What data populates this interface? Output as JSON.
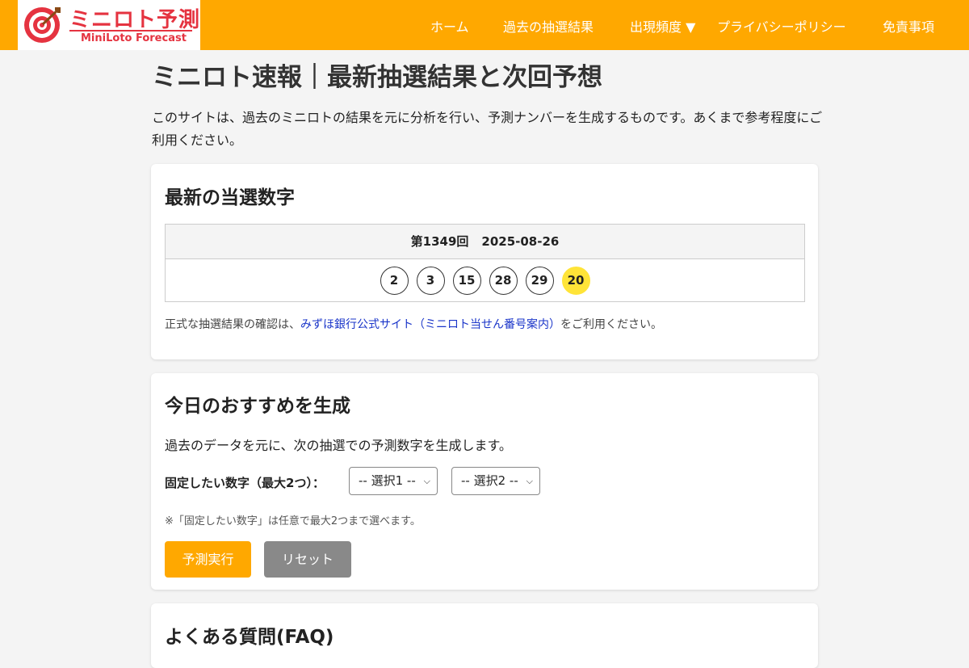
{
  "brand": {
    "title": "ミニロト予測",
    "subtitle": "MiniLoto Forecast",
    "colors": {
      "primary": "#FFA800",
      "logo_red": "#E53340",
      "bonus_ball": "#FFE438",
      "link": "#1a35c9"
    }
  },
  "nav": {
    "items": [
      {
        "label": "ホーム"
      },
      {
        "label": "過去の抽選結果"
      },
      {
        "label": "出現頻度 ▼"
      },
      {
        "label": "プライバシーポリシー"
      },
      {
        "label": "免責事項"
      }
    ]
  },
  "page": {
    "title": "ミニロト速報｜最新抽選結果と次回予想",
    "intro": "このサイトは、過去のミニロトの結果を元に分析を行い、予測ナンバーを生成するものです。あくまで参考程度にご利用ください。"
  },
  "latest": {
    "heading": "最新の当選数字",
    "draw_no": "第1349回",
    "date": "2025-08-26",
    "numbers": [
      "2",
      "3",
      "15",
      "28",
      "29"
    ],
    "bonus": "20",
    "note_prefix": "正式な抽選結果の確認は、",
    "note_link": "みずほ銀行公式サイト（ミニロト当せん番号案内）",
    "note_suffix": "をご利用ください。"
  },
  "generator": {
    "heading": "今日のおすすめを生成",
    "description": "過去のデータを元に、次の抽選での予測数字を生成します。",
    "fix_label": "固定したい数字（最大2つ）：",
    "select1": "-- 選択1 --",
    "select2": "-- 選択2 --",
    "hint": "※「固定したい数字」は任意で最大2つまで選べます。",
    "run_label": "予測実行",
    "reset_label": "リセット"
  },
  "faq": {
    "heading": "よくある質問(FAQ)"
  }
}
